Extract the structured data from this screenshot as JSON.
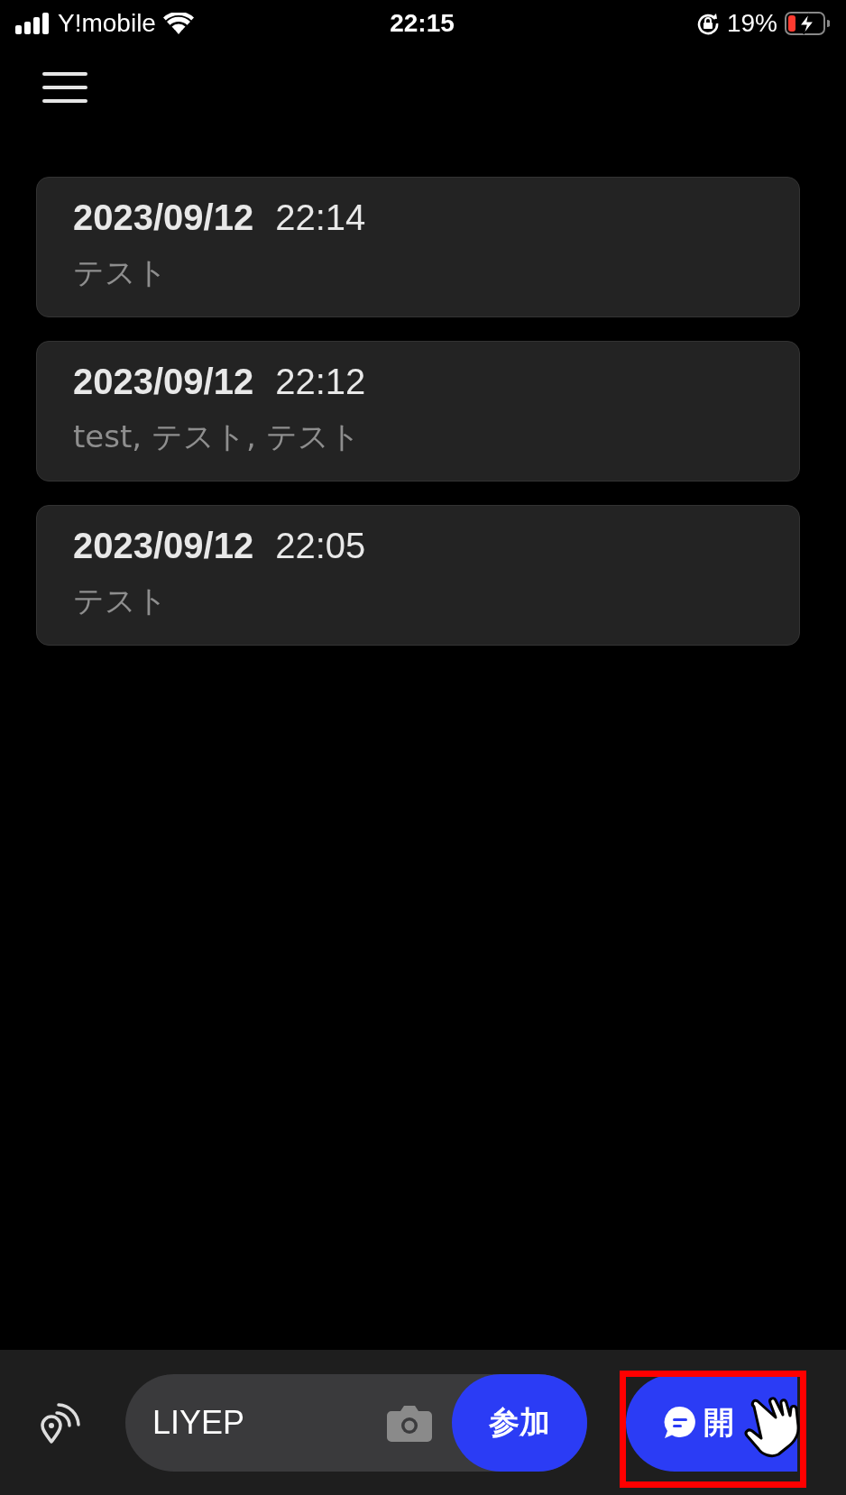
{
  "status_bar": {
    "carrier": "Y!mobile",
    "time": "22:15",
    "battery": "19%"
  },
  "history": [
    {
      "date": "2023/09/12",
      "time": "22:14",
      "words": "テスト"
    },
    {
      "date": "2023/09/12",
      "time": "22:12",
      "words": "test, テスト, テスト"
    },
    {
      "date": "2023/09/12",
      "time": "22:05",
      "words": "テスト"
    }
  ],
  "bottom_bar": {
    "room_code": "LIYEP",
    "join_button": "参加",
    "start_button": "開",
    "start_highlighted": true
  }
}
